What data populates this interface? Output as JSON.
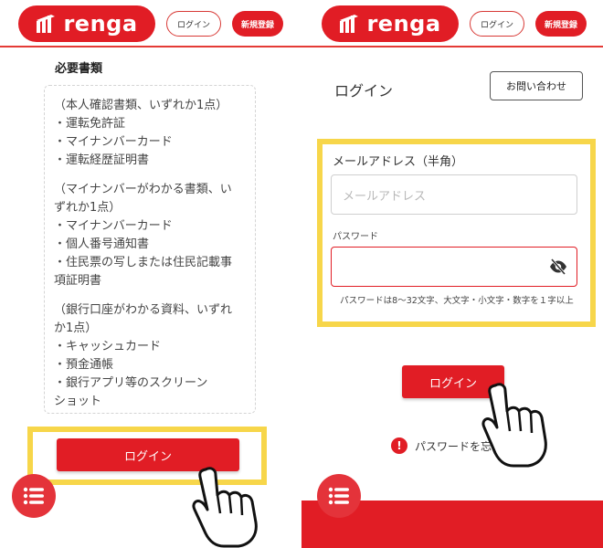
{
  "brand": {
    "logo_text": "renga",
    "accent": "#e11d25",
    "highlight": "#f7d64a"
  },
  "header": {
    "login_label": "ログイン",
    "register_label": "新規登録"
  },
  "left": {
    "section_title": "必要書類",
    "documents": [
      {
        "lines": [
          "（本人確認書類、いずれか1点）",
          "・運転免許証",
          "・マイナンバーカード",
          "・運転経歴証明書"
        ]
      },
      {
        "lines": [
          "（マイナンバーがわかる書類、い",
          "ずれか1点）",
          "・マイナンバーカード",
          "・個人番号通知書",
          "・住民票の写しまたは住民記載事",
          "項証明書"
        ]
      },
      {
        "lines": [
          "（銀行口座がわかる資料、いずれ",
          "か1点）",
          "・キャッシュカード",
          "・預金通帳",
          "・銀行アプリ等のスクリーン",
          "ショット"
        ]
      }
    ],
    "login_button": "ログイン"
  },
  "right": {
    "heading": "ログイン",
    "contact_button": "お問い合わせ",
    "email_label": "メールアドレス（半角）",
    "email_placeholder": "メールアドレス",
    "password_label": "パスワード",
    "password_hint": "パスワードは8〜32文字、大文字・小文字・数字を１字以上",
    "login_button": "ログイン",
    "error_text": "パスワードを忘"
  },
  "icons": {
    "menu": "menu-icon",
    "eye_off": "eye-off-icon",
    "hand_pointer": "hand-pointer-icon",
    "alert": "alert-icon"
  }
}
